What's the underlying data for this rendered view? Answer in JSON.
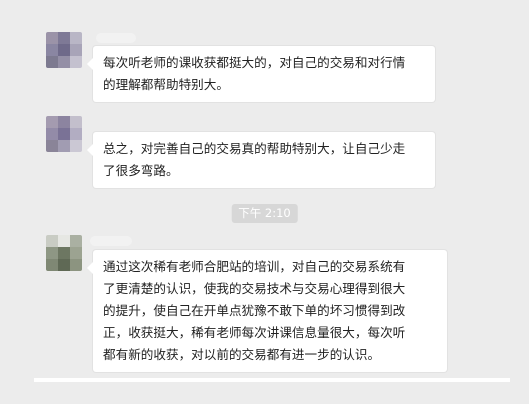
{
  "messages": [
    {
      "text": "每次听老师的课收获都挺大的，对自己的交易和对行情\n的理解都帮助特别大。"
    },
    {
      "text": "总之，对完善自己的交易真的帮助特别大，让自己少走\n了很多弯路。"
    },
    {
      "text": "通过这次稀有老师合肥站的培训，对自己的交易系统有\n了更清楚的认识，使我的交易技术与交易心理得到很大\n的提升，使自己在开单点犹豫不敢下单的坏习惯得到改\n正，收获挺大，稀有老师每次讲课信息量很大，每次听\n都有新的收获，对以前的交易都有进一步的认识。"
    }
  ],
  "timestamp": "下午 2:10",
  "colors": {
    "background": "#ececec",
    "bubble": "#ffffff",
    "timestamp_bg": "#d7d7d7"
  }
}
